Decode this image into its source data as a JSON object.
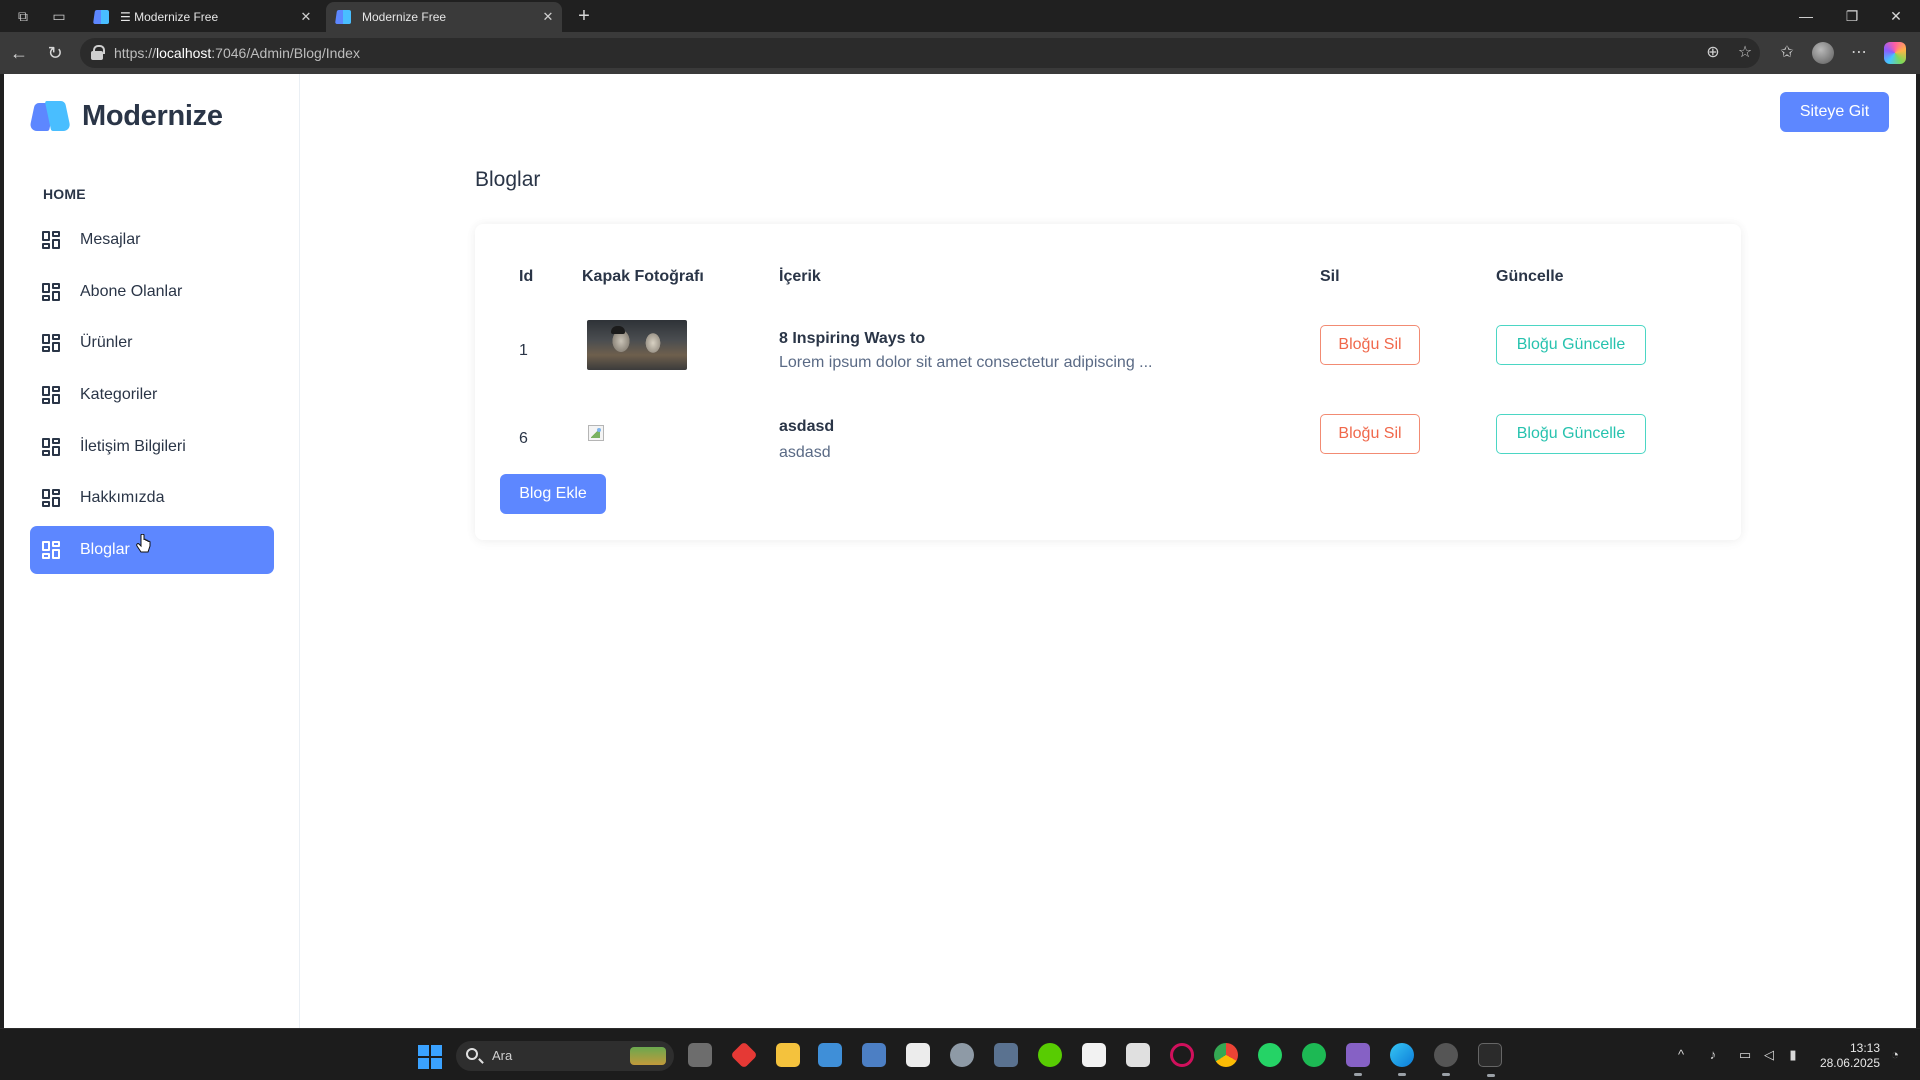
{
  "browser": {
    "tabs": [
      {
        "label": "Modernize Free",
        "prefix": "☰ ",
        "active": false
      },
      {
        "label": "Modernize Free",
        "prefix": "",
        "active": true
      }
    ],
    "url_prefix": "https://",
    "url_host": "localhost",
    "url_rest": ":7046/Admin/Blog/Index"
  },
  "brand": {
    "name": "Modernize"
  },
  "sidebar": {
    "caption": "HOME",
    "items": [
      {
        "label": "Mesajlar",
        "active": false
      },
      {
        "label": "Abone Olanlar",
        "active": false
      },
      {
        "label": "Ürünler",
        "active": false
      },
      {
        "label": "Kategoriler",
        "active": false
      },
      {
        "label": "İletişim Bilgileri",
        "active": false
      },
      {
        "label": "Hakkımızda",
        "active": false
      },
      {
        "label": "Bloglar",
        "active": true
      }
    ]
  },
  "header": {
    "site_button": "Siteye Git"
  },
  "page": {
    "title": "Bloglar"
  },
  "table": {
    "headers": {
      "id": "Id",
      "cover": "Kapak Fotoğrafı",
      "content": "İçerik",
      "delete": "Sil",
      "update": "Güncelle"
    },
    "rows": [
      {
        "id": "1",
        "title": "8 Inspiring Ways to",
        "excerpt": "Lorem ipsum dolor sit amet consectetur adipiscing ...",
        "has_image": true,
        "delete_label": "Bloğu Sil",
        "update_label": "Bloğu Güncelle"
      },
      {
        "id": "6",
        "title": "asdasd",
        "excerpt": "asdasd",
        "has_image": false,
        "delete_label": "Bloğu Sil",
        "update_label": "Bloğu Güncelle"
      }
    ]
  },
  "actions": {
    "add_blog": "Blog Ekle"
  },
  "taskbar": {
    "search_placeholder": "Ara",
    "time": "13:13",
    "date": "28.06.2025"
  },
  "colors": {
    "primary": "#5d87ff",
    "danger": "#f0684b",
    "success": "#26c2ae",
    "text": "#2a3547"
  }
}
